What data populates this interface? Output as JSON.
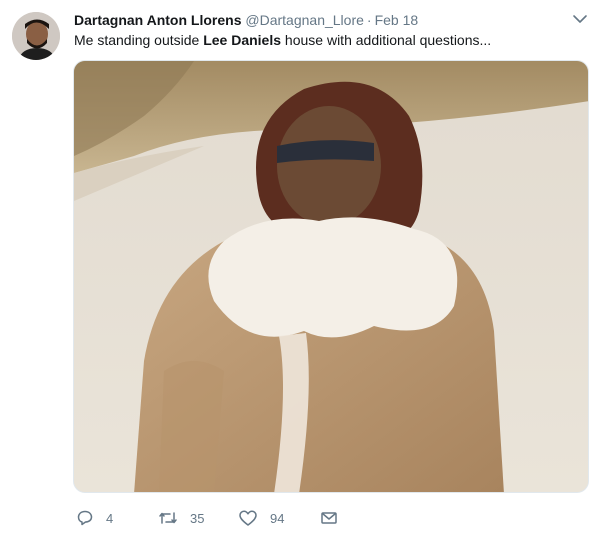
{
  "tweet": {
    "display_name": "Dartagnan Anton Llorens",
    "handle": "@Dartagnan_Llore",
    "separator": "·",
    "timestamp": "Feb 18",
    "text_before": "Me standing outside ",
    "text_bold": "Lee Daniels",
    "text_after": " house with additional questions...",
    "replies": "4",
    "retweets": "35",
    "likes": "94"
  },
  "icons": {
    "avatar": "avatar",
    "menu": "chevron-down-icon",
    "reply": "reply-icon",
    "retweet": "retweet-icon",
    "like": "heart-icon",
    "dm": "envelope-icon"
  },
  "colors": {
    "name": "#14171a",
    "secondary": "#657786",
    "border": "#e1e8ed"
  }
}
